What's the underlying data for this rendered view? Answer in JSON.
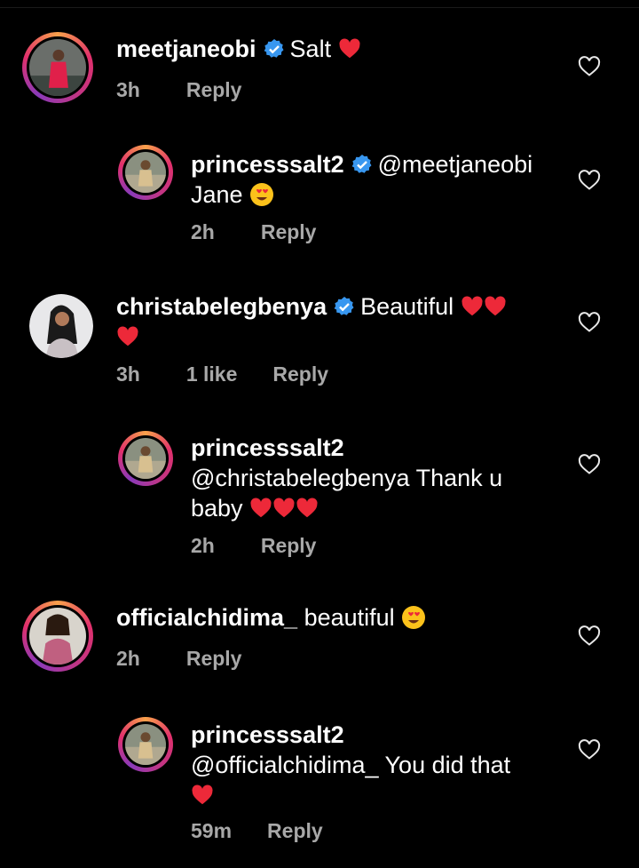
{
  "comments": [
    {
      "user": "meetjaneobi",
      "verified": true,
      "text": "Salt",
      "time": "3h",
      "likes": "",
      "reply": "Reply"
    },
    {
      "user": "princesssalt2",
      "verified": true,
      "mention": "@meetjaneobi",
      "text": "Jane",
      "time": "2h",
      "likes": "",
      "reply": "Reply"
    },
    {
      "user": "christabelegbenya",
      "verified": true,
      "text": "Beautiful",
      "time": "3h",
      "likes": "1 like",
      "reply": "Reply"
    },
    {
      "user": "princesssalt2",
      "verified": false,
      "text": "@christabelegbenya Thank u",
      "text2": "baby",
      "time": "2h",
      "likes": "",
      "reply": "Reply"
    },
    {
      "user": "officialchidima_",
      "verified": false,
      "text": "beautiful",
      "time": "2h",
      "likes": "",
      "reply": "Reply"
    },
    {
      "user": "princesssalt2",
      "verified": false,
      "text": "@officialchidima_ You did that",
      "time": "59m",
      "likes": "",
      "reply": "Reply"
    }
  ],
  "icons": {
    "verified": "verified-badge-icon",
    "like": "heart-outline-icon",
    "heart": "red-heart-emoji",
    "face": "heart-eyes-emoji"
  },
  "colors": {
    "background": "#000000",
    "verified": "#3897f0",
    "heart": "#ed2939",
    "meta": "#a8a8a8"
  }
}
